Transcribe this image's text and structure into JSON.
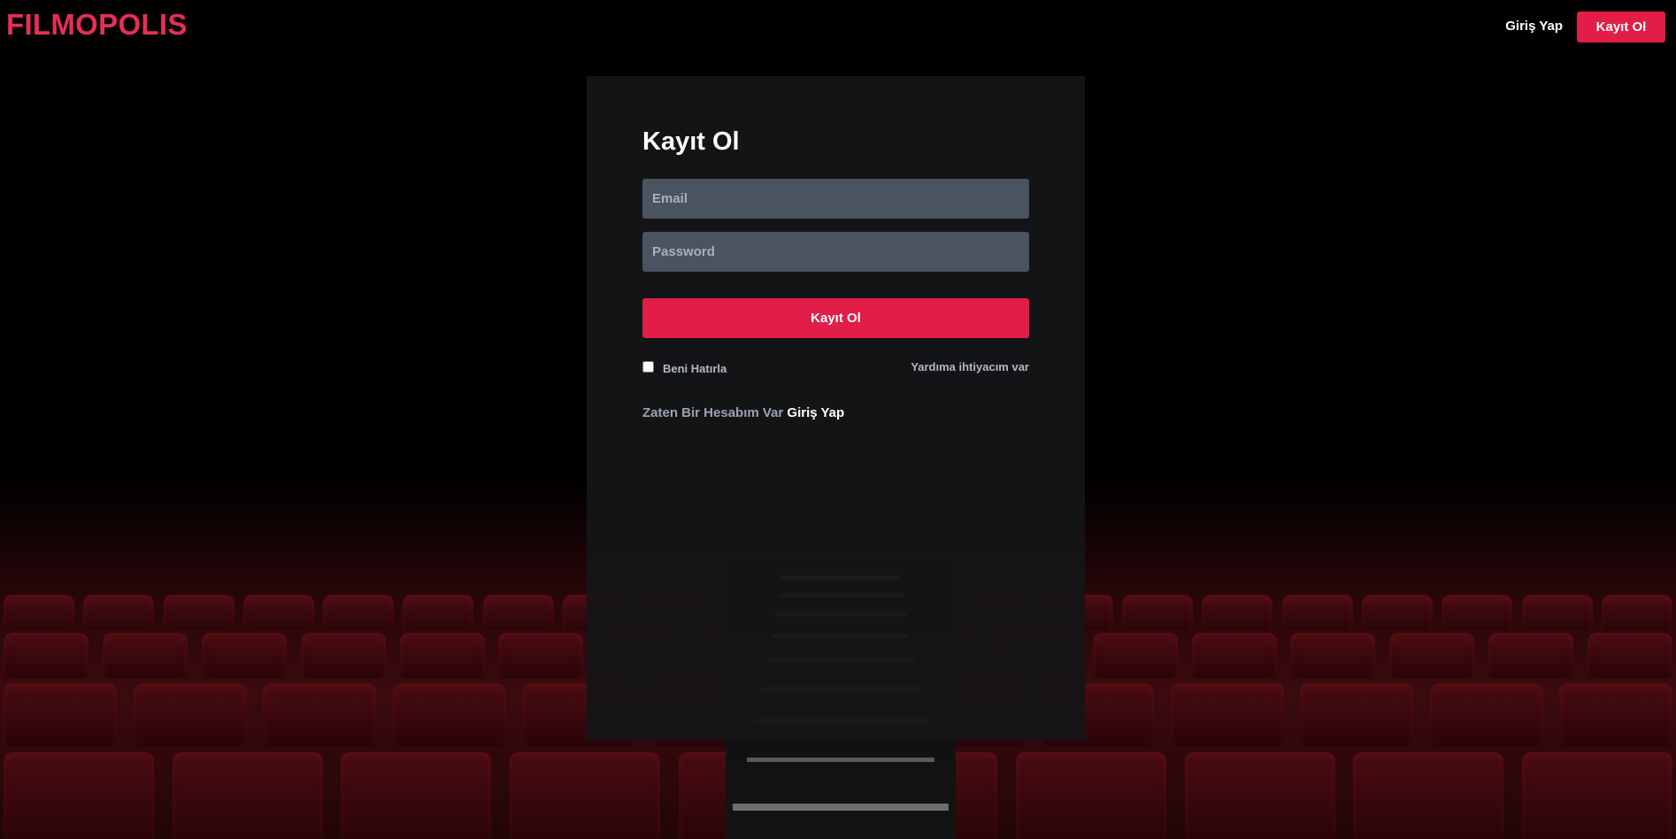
{
  "brand": {
    "name": "FILMOPOLIS",
    "color": "#e62f55"
  },
  "nav": {
    "login_label": "Giriş Yap",
    "signup_label": "Kayıt Ol"
  },
  "form": {
    "title": "Kayıt Ol",
    "email_placeholder": "Email",
    "password_placeholder": "Password",
    "submit_label": "Kayıt Ol",
    "remember_label": "Beni Hatırla",
    "help_label": "Yardıma ihtiyacım var",
    "have_account_text": "Zaten Bir Hesabım Var",
    "login_link_label": "Giriş Yap"
  },
  "colors": {
    "accent": "#e11d48",
    "card_bg": "#141518",
    "input_bg": "#4a5360"
  },
  "icons": [
    "theater-seats-background"
  ]
}
